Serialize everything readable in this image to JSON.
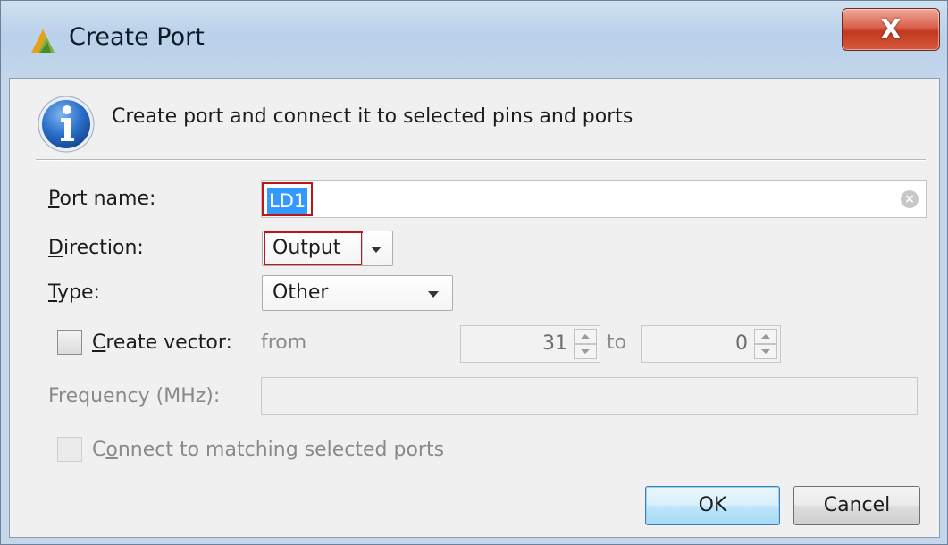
{
  "window": {
    "title": "Create Port",
    "close_label": "X"
  },
  "header": {
    "message": "Create port and connect it to selected pins and ports"
  },
  "form": {
    "port_name": {
      "label_ul": "P",
      "label_rest": "ort name:",
      "value": "LD1"
    },
    "direction": {
      "label_ul": "D",
      "label_rest": "irection:",
      "value": "Output"
    },
    "type": {
      "label_ul": "T",
      "label_rest": "ype:",
      "value": "Other"
    },
    "create_vector": {
      "label_ul": "C",
      "label_rest": "reate vector:",
      "checked": false,
      "from_label": "from",
      "from_value": "31",
      "to_label": "to",
      "to_value": "0"
    },
    "frequency": {
      "label": "Frequency (MHz):",
      "value": ""
    },
    "connect_matching": {
      "label_pre": "C",
      "label_ul": "o",
      "label_rest": "nnect to matching selected ports",
      "checked": false
    }
  },
  "buttons": {
    "ok": "OK",
    "cancel": "Cancel"
  },
  "colors": {
    "highlight_box": "#c0141b",
    "selection": "#3399ff"
  }
}
